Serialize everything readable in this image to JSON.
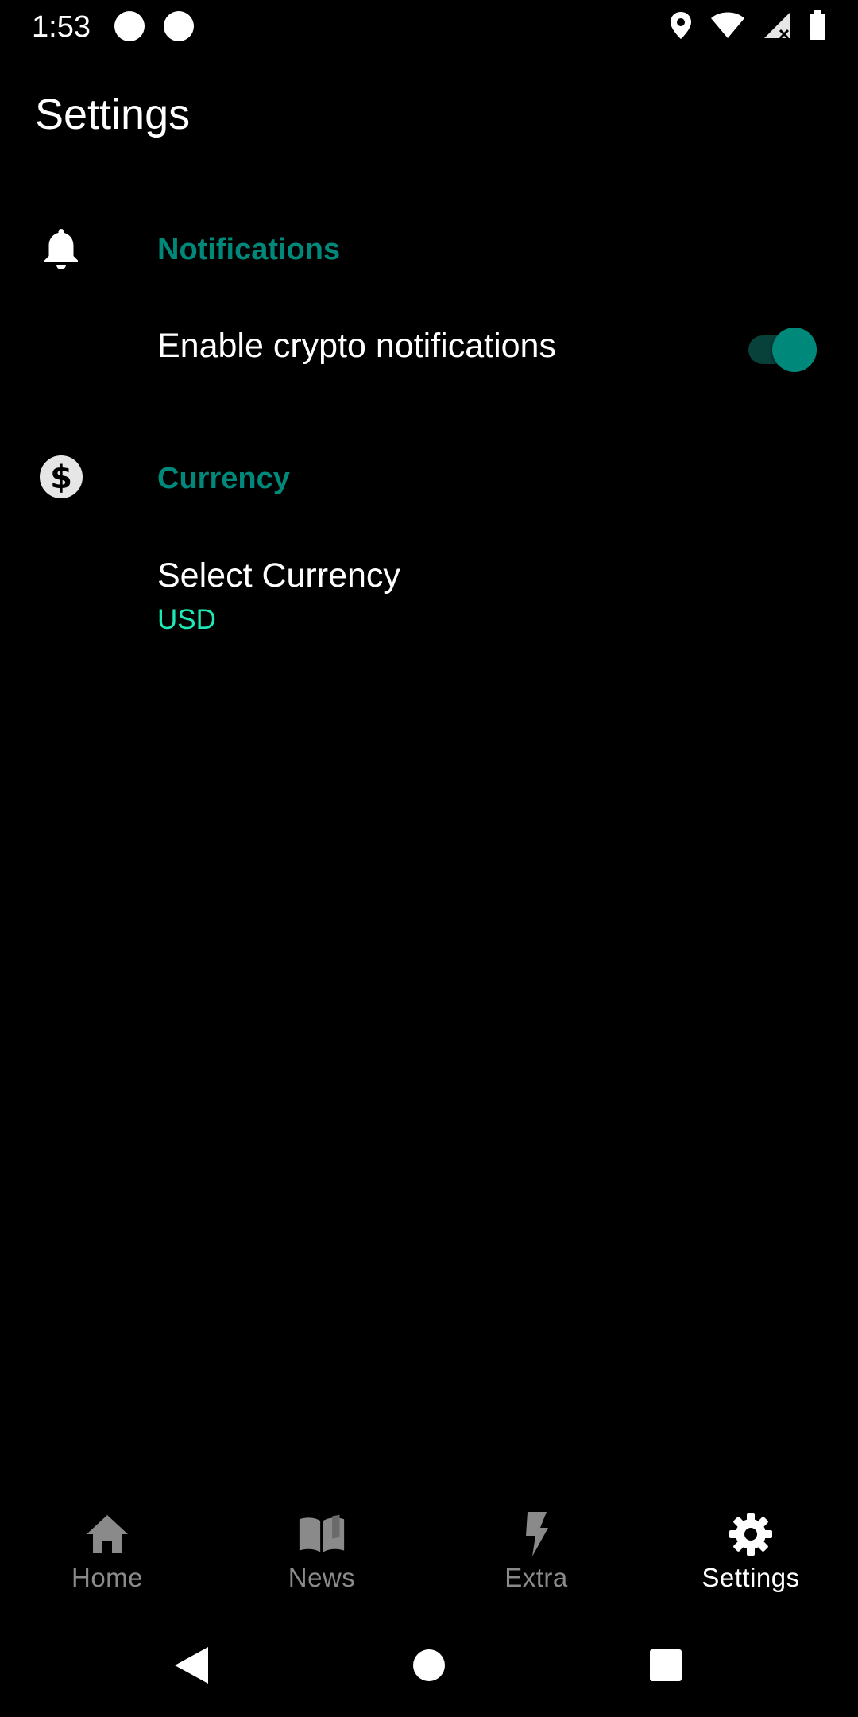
{
  "status_bar": {
    "time": "1:53",
    "icons": [
      "location-icon",
      "wifi-icon",
      "signal-icon",
      "battery-icon"
    ]
  },
  "page": {
    "title": "Settings"
  },
  "sections": {
    "notifications": {
      "title": "Notifications",
      "icon": "bell-icon",
      "pref_title": "Enable crypto notifications",
      "enabled": true
    },
    "currency": {
      "title": "Currency",
      "icon": "dollar-circle-icon",
      "pref_title": "Select Currency",
      "pref_value": "USD"
    }
  },
  "bottom_nav": {
    "items": [
      {
        "label": "Home",
        "icon": "home-icon",
        "active": false
      },
      {
        "label": "News",
        "icon": "book-icon",
        "active": false
      },
      {
        "label": "Extra",
        "icon": "bolt-icon",
        "active": false
      },
      {
        "label": "Settings",
        "icon": "gear-icon",
        "active": true
      }
    ]
  },
  "colors": {
    "accent": "#00897b",
    "summary": "#1de9b6",
    "background": "#000000",
    "inactive": "#8a8a8a"
  }
}
